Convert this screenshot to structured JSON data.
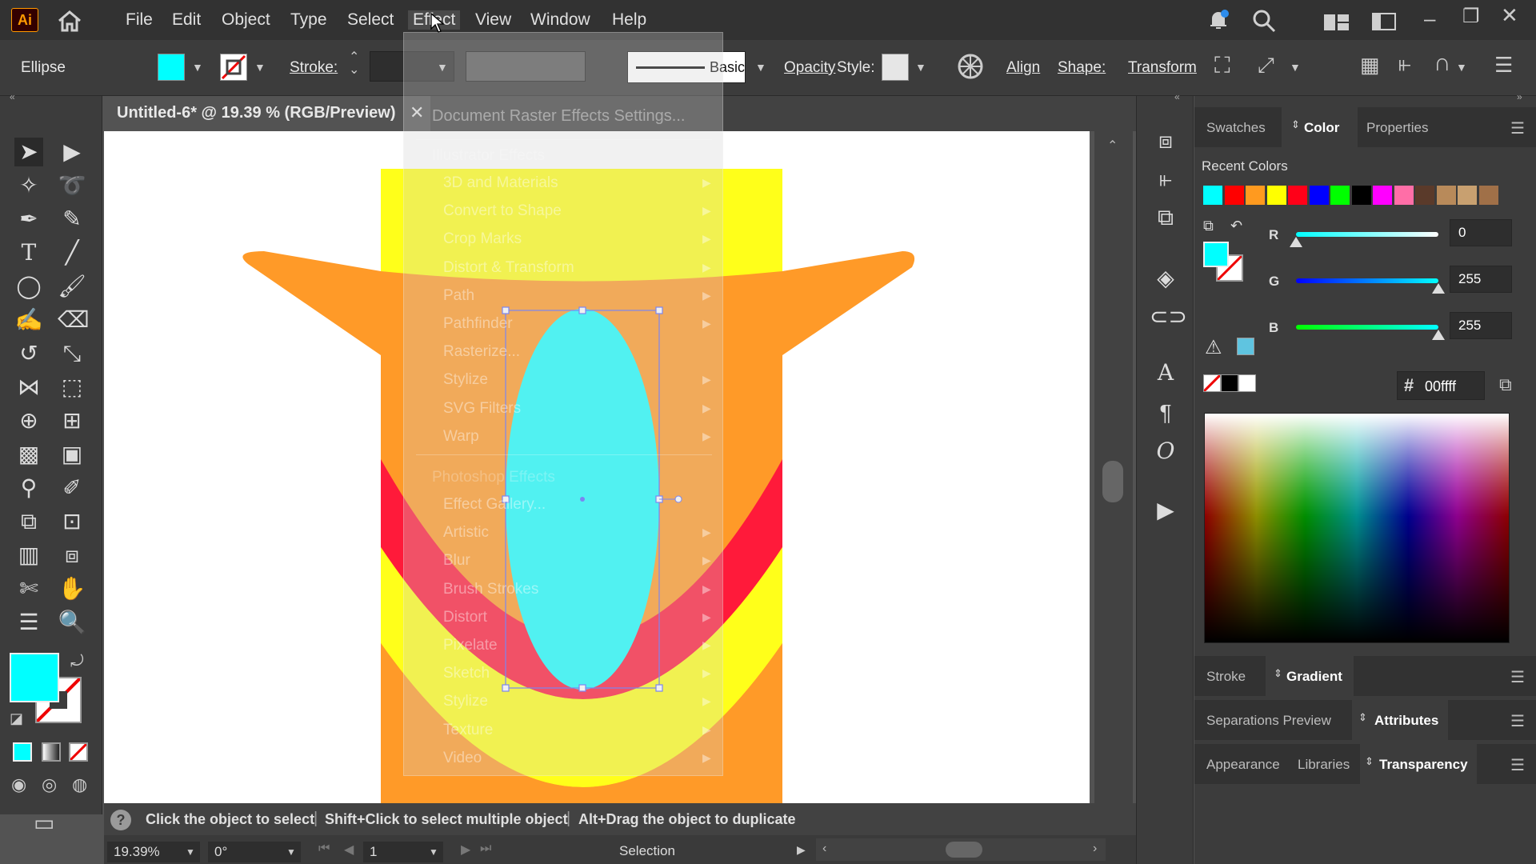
{
  "app": {
    "logo": "Ai"
  },
  "menubar": {
    "items": [
      "File",
      "Edit",
      "Object",
      "Type",
      "Select",
      "Effect",
      "View",
      "Window",
      "Help"
    ],
    "active": "Effect"
  },
  "control": {
    "object_type": "Ellipse",
    "stroke_label": "Stroke:",
    "brush_label": "Basic",
    "opacity_label": "Opacity",
    "style_label": "Style:",
    "align_label": "Align",
    "shape_label": "Shape:",
    "transform_label": "Transform",
    "fill_color": "#00ffff"
  },
  "document": {
    "tab_title": "Untitled-6* @ 19.39 % (RGB/Preview)",
    "close_glyph": "✕"
  },
  "effect_menu": {
    "raster_settings": "Document Raster Effects Settings...",
    "illustrator_header": "Illustrator Effects",
    "illustrator_items": [
      "3D and Materials",
      "Convert to Shape",
      "Crop Marks",
      "Distort & Transform",
      "Path",
      "Pathfinder",
      "Rasterize...",
      "Stylize",
      "SVG Filters",
      "Warp"
    ],
    "photoshop_header": "Photoshop Effects",
    "photoshop_items": [
      "Effect Gallery...",
      "Artistic",
      "Blur",
      "Brush Strokes",
      "Distort",
      "Pixelate",
      "Sketch",
      "Stylize",
      "Texture",
      "Video"
    ]
  },
  "status": {
    "hint": "Click the object to select",
    "hint2": "Shift+Click to select multiple object",
    "hint3": "Alt+Drag the object to duplicate",
    "zoom": "19.39%",
    "rotation": "0°",
    "artboard_num": "1",
    "tool_name": "Selection"
  },
  "panels": {
    "top_tabs": [
      "Swatches",
      "Color",
      "Properties"
    ],
    "active_top_tab": "Color",
    "recent_colors_label": "Recent Colors",
    "recent_colors": [
      "#00ffff",
      "#ff0000",
      "#ff9a1f",
      "#ffff00",
      "#ff0018",
      "#0000ff",
      "#00ff00",
      "#000000",
      "#ff00ff",
      "#ff6ea7",
      "#5a3a2a",
      "#b88a5a",
      "#c8a070",
      "#a07048"
    ],
    "r_label": "R",
    "r_value": "0",
    "g_label": "G",
    "g_value": "255",
    "b_label": "B",
    "b_value": "255",
    "r_level": 0,
    "g_level": 1,
    "b_level": 1,
    "hex_symbol": "#",
    "hex_value": "00ffff",
    "stroke_tab": "Stroke",
    "gradient_tab": "Gradient",
    "separations_tab": "Separations Preview",
    "attributes_tab": "Attributes",
    "appearance_tab": "Appearance",
    "libraries_tab": "Libraries",
    "transparency_tab": "Transparency"
  },
  "colors": {
    "yellow": "#ffff1a",
    "orange": "#ff9a28",
    "red": "#ff1a3a",
    "cyan": "#1affff"
  }
}
